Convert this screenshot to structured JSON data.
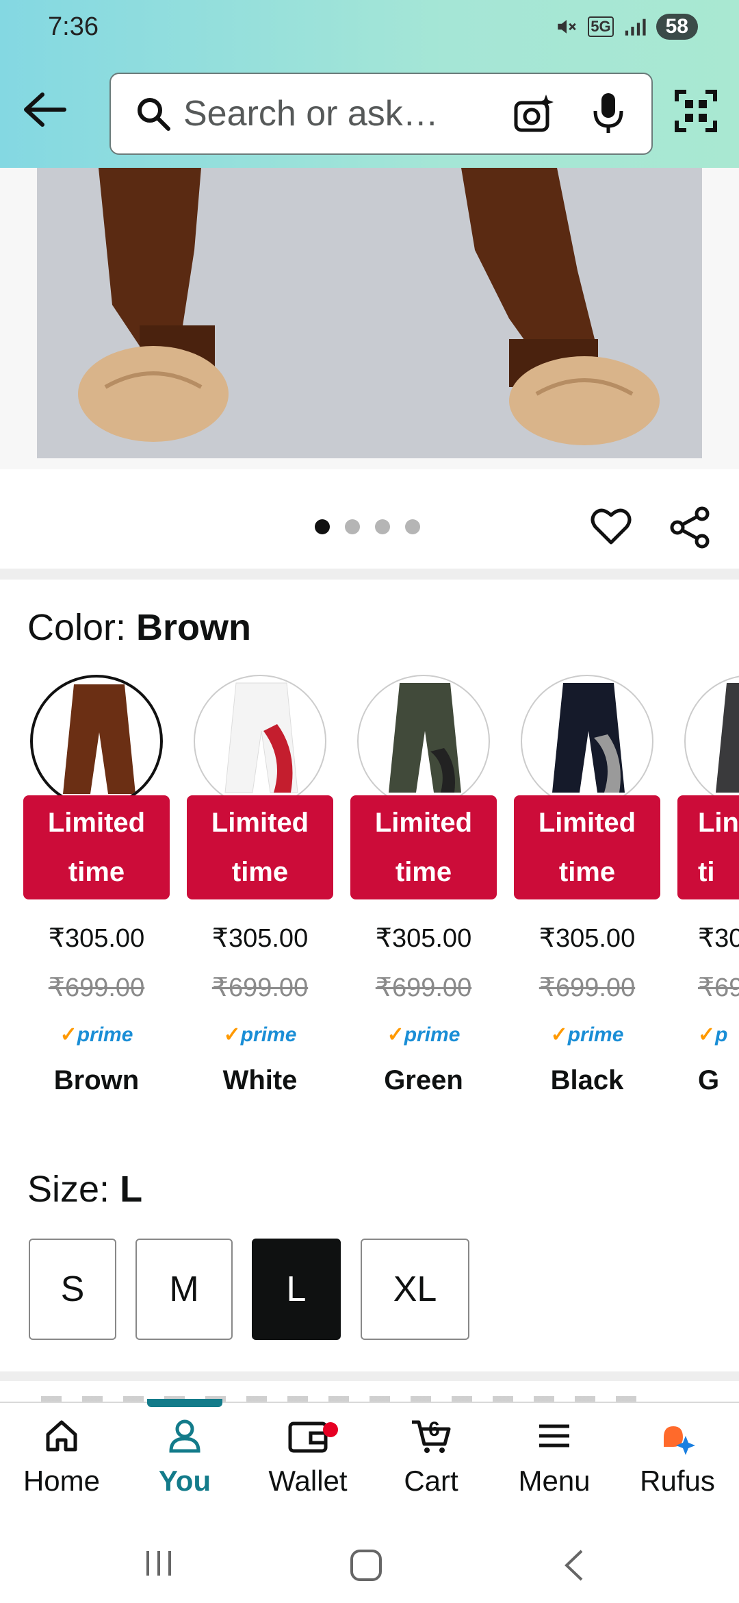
{
  "status_bar": {
    "time": "7:36",
    "network": "5G",
    "battery": "58"
  },
  "search": {
    "placeholder": "Search or ask…"
  },
  "gallery": {
    "pages": 4,
    "current_page": 1
  },
  "color_section": {
    "label": "Color: ",
    "selected": "Brown",
    "swatches": [
      {
        "name": "Brown",
        "badge_line1": "Limited",
        "badge_line2": "time",
        "price": "₹305.00",
        "mrp": "₹699.00",
        "prime": "prime",
        "fill": "#6b2f14"
      },
      {
        "name": "White",
        "badge_line1": "Limited",
        "badge_line2": "time",
        "price": "₹305.00",
        "mrp": "₹699.00",
        "prime": "prime",
        "fill": "#f4f4f4"
      },
      {
        "name": "Green",
        "badge_line1": "Limited",
        "badge_line2": "time",
        "price": "₹305.00",
        "mrp": "₹699.00",
        "prime": "prime",
        "fill": "#414a3a"
      },
      {
        "name": "Black",
        "badge_line1": "Limited",
        "badge_line2": "time",
        "price": "₹305.00",
        "mrp": "₹699.00",
        "prime": "prime",
        "fill": "#151a2a"
      },
      {
        "name": "G",
        "badge_line1": "Lin",
        "badge_line2": "ti",
        "price": "₹30",
        "mrp": "₹69",
        "prime": "p",
        "fill": "#3a3a3c"
      }
    ]
  },
  "size_section": {
    "label": "Size: ",
    "selected": "L",
    "options": [
      "S",
      "M",
      "L",
      "XL"
    ]
  },
  "bottom_nav": {
    "items": [
      {
        "label": "Home"
      },
      {
        "label": "You"
      },
      {
        "label": "Wallet"
      },
      {
        "label": "Cart"
      },
      {
        "label": "Menu"
      },
      {
        "label": "Rufus"
      }
    ],
    "active": "You",
    "cart_count": "6"
  },
  "colors": {
    "accent": "#137b8a",
    "badge": "#cc0c39",
    "prime": "#1a8ed6"
  }
}
